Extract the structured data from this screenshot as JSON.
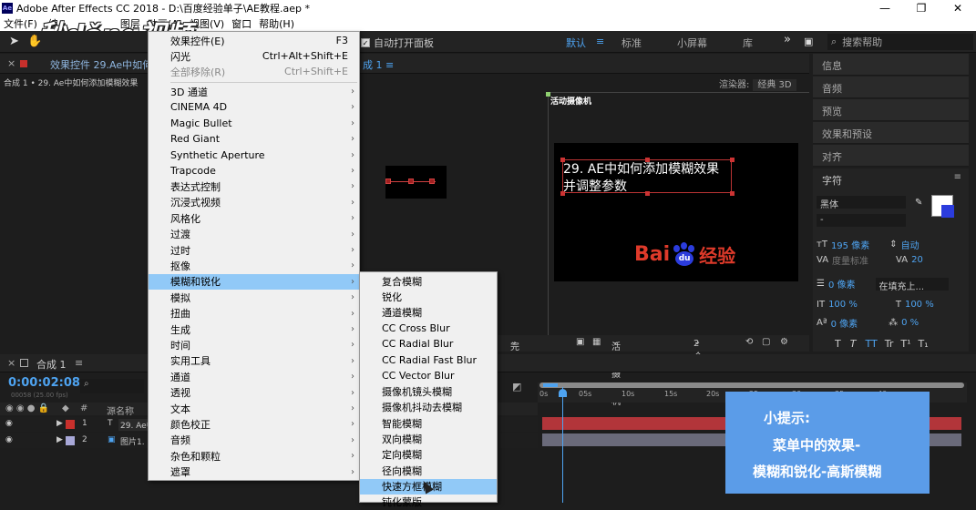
{
  "window": {
    "title": "Adobe After Effects CC 2018 - D:\\百度经验单子\\AE教程.aep *",
    "app_icon": "Ae",
    "min": "—",
    "restore": "❐",
    "close": "✕"
  },
  "watermark": "秒dǒng视频",
  "menubar": [
    "文件(F)",
    "编",
    "图层",
    "动画(A)",
    "视图(V)",
    "窗口",
    "帮助(H)"
  ],
  "toolbar": {
    "auto_open": "自动打开面板",
    "workspaces": [
      "默认",
      "标准",
      "小屏幕",
      "库"
    ],
    "more": "»",
    "search_placeholder": "搜索帮助"
  },
  "effect_panel": {
    "tab": "效果控件 29.Ae中如何",
    "breadcrumb": "合成 1 • 29. Ae中如何添加模糊效果",
    "comp_tab": "成 1"
  },
  "viewer": {
    "renderer_label": "渲染器:",
    "renderer_value": "经典 3D",
    "camera_label": "活动摄像机",
    "text_line1": "29. AE中如何添加模糊效果",
    "text_line2": "并调整参数",
    "baidu_bai": "Bai",
    "baidu_du": "du",
    "baidu_jy": "经验",
    "bar_quality": "完整",
    "bar_camera": "活动摄像机",
    "bar_views": "2 个..."
  },
  "right_panels": [
    "信息",
    "音频",
    "预览",
    "效果和预设",
    "对齐"
  ],
  "character": {
    "title": "字符",
    "font": "黑体",
    "style": "-",
    "size": "195 像素",
    "leading": "自动",
    "kerning": "度量标准",
    "tracking": "20",
    "stroke": "0 像素",
    "stroke_mode": "在填充上...",
    "vscale": "100 %",
    "hscale": "100 %",
    "baseline": "0 像素",
    "tsume": "0 %",
    "styles": [
      "T",
      "T",
      "TT",
      "Tr",
      "T¹",
      "T₁"
    ]
  },
  "timeline": {
    "tab": "合成 1",
    "timecode": "0:00:02:08",
    "timecode_sub": "00058 (25.00 fps)",
    "col_source": "源名称",
    "layers": [
      {
        "num": "1",
        "name": "29. Ae中",
        "type": "T",
        "color": "#c8302c"
      },
      {
        "num": "2",
        "name": "图片1.",
        "type": "▣",
        "color": "#a8a8d8"
      }
    ],
    "ruler": [
      "0s",
      "05s",
      "10s",
      "15s",
      "20s",
      "25s",
      "30s",
      "35s",
      "40s"
    ]
  },
  "tip": {
    "line1": "小提示:",
    "line2": "菜单中的效果-",
    "line3": "模糊和锐化-高斯模糊"
  },
  "effect_menu": {
    "top": [
      {
        "label": "效果控件(E)",
        "shortcut": "F3"
      },
      {
        "label": "闪光",
        "shortcut": "Ctrl+Alt+Shift+E"
      },
      {
        "label": "全部移除(R)",
        "shortcut": "Ctrl+Shift+E"
      }
    ],
    "items": [
      "3D 通道",
      "CINEMA 4D",
      "Magic Bullet",
      "Red Giant",
      "Synthetic Aperture",
      "Trapcode",
      "表达式控制",
      "沉浸式视频",
      "风格化",
      "过渡",
      "过时",
      "抠像",
      "模糊和锐化",
      "模拟",
      "扭曲",
      "生成",
      "时间",
      "实用工具",
      "通道",
      "透视",
      "文本",
      "颜色校正",
      "音频",
      "杂色和颗粒",
      "遮罩"
    ]
  },
  "blur_menu": [
    "复合模糊",
    "锐化",
    "通道模糊",
    "CC Cross Blur",
    "CC Radial Blur",
    "CC Radial Fast Blur",
    "CC Vector Blur",
    "摄像机镜头模糊",
    "摄像机抖动去模糊",
    "智能模糊",
    "双向模糊",
    "定向模糊",
    "径向模糊",
    "快速方框模糊",
    "钝化蒙版"
  ]
}
